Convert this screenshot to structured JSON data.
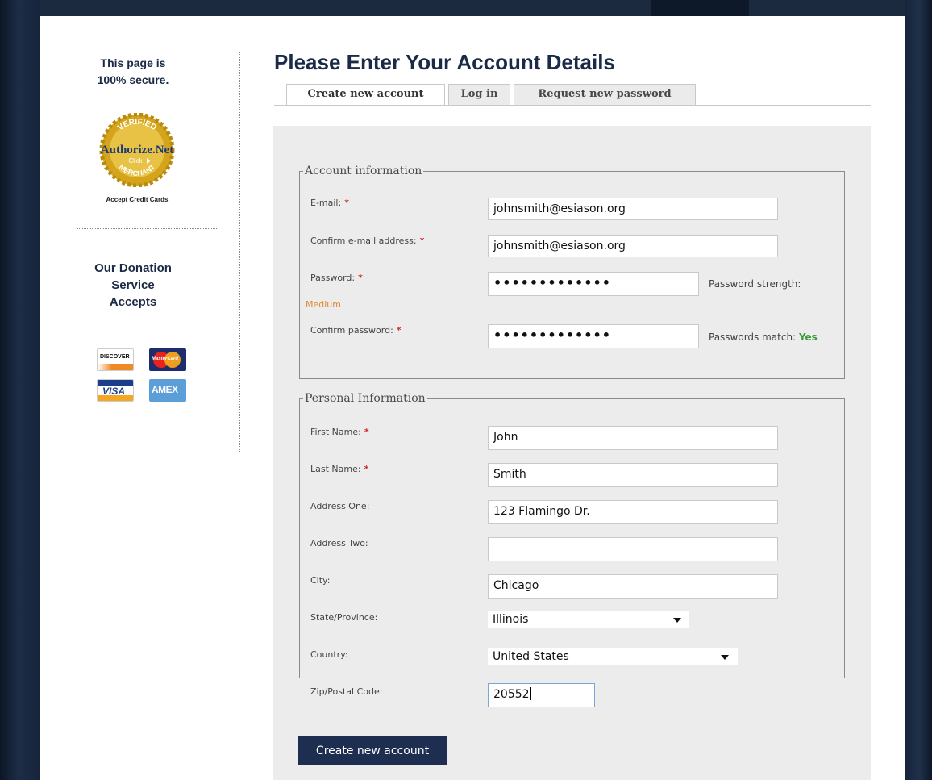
{
  "sidebar": {
    "secure_line1": "This page is",
    "secure_line2": "100% secure.",
    "seal": {
      "top_text": "VERIFIED",
      "brand": "Authorize.Net",
      "click_text": "Click",
      "bottom_text": "MERCHANT"
    },
    "seal_caption": "Accept Credit Cards",
    "donation_line1": "Our Donation",
    "donation_line2": "Service",
    "donation_line3": "Accepts",
    "cards": {
      "discover": "DISCOVER",
      "mastercard": "MasterCard",
      "visa": "VISA",
      "amex": "AMEX"
    }
  },
  "main": {
    "title": "Please Enter Your Account Details",
    "tabs": [
      {
        "label": "Create new account",
        "active": true
      },
      {
        "label": "Log in",
        "active": false
      },
      {
        "label": "Request new password",
        "active": false
      }
    ]
  },
  "form": {
    "required_marker": "*",
    "account_legend": "Account information",
    "email_label": "E-mail:",
    "email_value": "johnsmith@esiason.org",
    "confirm_email_label": "Confirm e-mail address:",
    "confirm_email_value": "johnsmith@esiason.org",
    "password_label": "Password:",
    "password_mask": "•••••••••••••",
    "password_strength_label": "Password strength:",
    "password_strength_value": "Medium",
    "confirm_password_label": "Confirm password:",
    "confirm_password_mask": "•••••••••••••",
    "passwords_match_label": "Passwords match:",
    "passwords_match_value": "Yes",
    "personal_legend": "Personal Information",
    "first_name_label": "First Name:",
    "first_name_value": "John",
    "last_name_label": "Last Name:",
    "last_name_value": "Smith",
    "address1_label": "Address One:",
    "address1_value": "123 Flamingo Dr.",
    "address2_label": "Address Two:",
    "address2_value": "",
    "city_label": "City:",
    "city_value": "Chicago",
    "state_label": "State/Province:",
    "state_value": "Illinois",
    "country_label": "Country:",
    "country_value": "United States",
    "zip_label": "Zip/Postal Code:",
    "zip_value": "20552",
    "submit_label": "Create new account"
  },
  "colors": {
    "frame": "#0f1b2e",
    "heading": "#1b2a47",
    "button": "#1d2e50",
    "required": "#cc2a2a",
    "strength_medium": "#e0892b",
    "match_yes": "#3a9a3a",
    "panel": "#ececec"
  }
}
